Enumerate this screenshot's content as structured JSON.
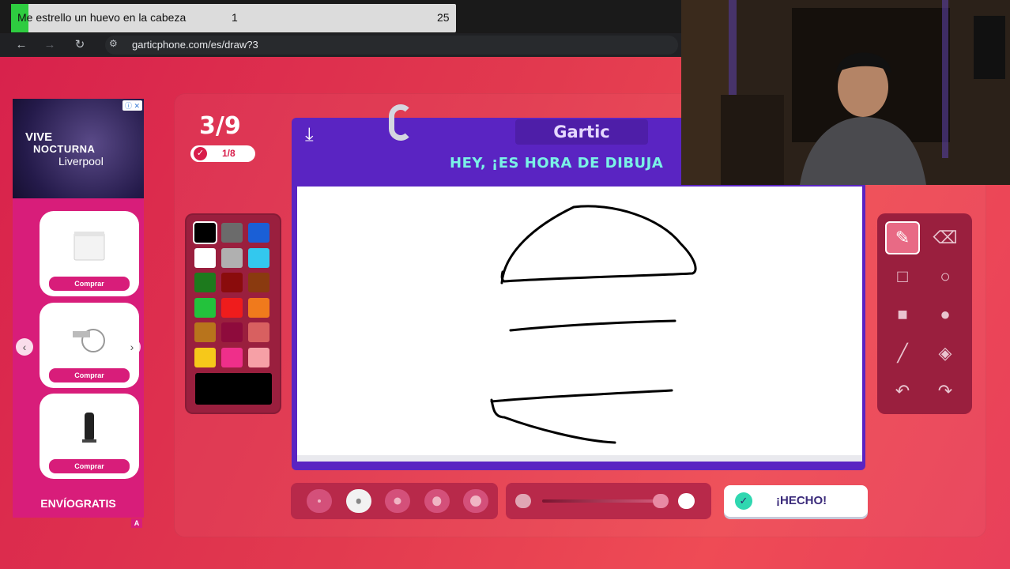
{
  "overlay": {
    "text": "Me estrello un huevo en la cabeza",
    "count_1": "1",
    "count_2": "25",
    "accent": "#2ecc40"
  },
  "browser": {
    "url": "garticphone.com/es/draw?3",
    "back_icon": "arrow-left",
    "forward_icon": "arrow-right",
    "reload_icon": "reload"
  },
  "ad": {
    "line1": "VIVE",
    "line2": "NOCTURNA",
    "line3": "Liverpool",
    "products": [
      {
        "image": "freezer",
        "button": "Comprar"
      },
      {
        "image": "water-pump",
        "button": "Comprar"
      },
      {
        "image": "tower-heater",
        "button": "Comprar"
      }
    ],
    "footer": "ENVÍOGRATIS",
    "badge": "A",
    "brand_color": "#d81d7a"
  },
  "progress": {
    "round": "3/9",
    "completed": "1/8"
  },
  "palette": {
    "colors": [
      "#000000",
      "#6b6b6b",
      "#1a5fd6",
      "#ffffff",
      "#b0b0b0",
      "#33c8ee",
      "#1d7a1d",
      "#8a0c0c",
      "#8a3a0f",
      "#23c23c",
      "#ef1c1c",
      "#f07a1c",
      "#b8741c",
      "#8e0b3c",
      "#d86060",
      "#f6c81a",
      "#ef2f8a",
      "#f6a0a6"
    ],
    "selected": "#000000"
  },
  "notebook": {
    "brand": "Gartic",
    "instruction": "HEY, ¡ES HORA DE DIBUJA",
    "download_icon": "download"
  },
  "tools": [
    {
      "name": "pencil",
      "glyph": "✎"
    },
    {
      "name": "eraser",
      "glyph": "⌫"
    },
    {
      "name": "rectangle-outline",
      "glyph": "□"
    },
    {
      "name": "ellipse-outline",
      "glyph": "○"
    },
    {
      "name": "rectangle-filled",
      "glyph": "■"
    },
    {
      "name": "ellipse-filled",
      "glyph": "●"
    },
    {
      "name": "line",
      "glyph": "╱"
    },
    {
      "name": "fill-bucket",
      "glyph": "◈"
    },
    {
      "name": "undo",
      "glyph": "↶"
    },
    {
      "name": "redo",
      "glyph": "↷"
    }
  ],
  "brush_sizes": {
    "count": 5,
    "selected_index": 1
  },
  "opacity": {
    "value": 1.0
  },
  "done_button": {
    "label": "¡HECHO!"
  }
}
